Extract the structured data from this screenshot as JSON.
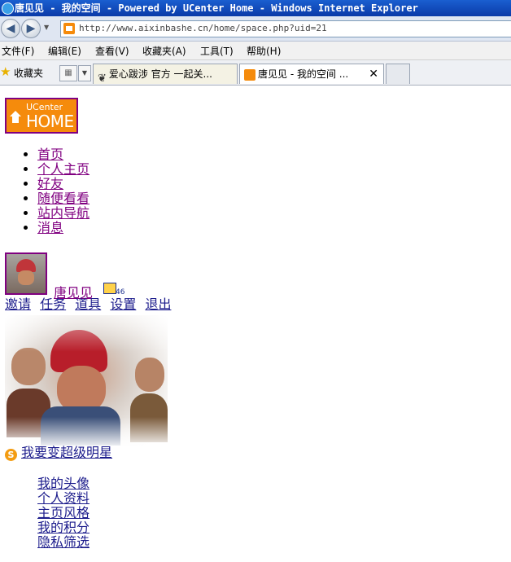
{
  "window": {
    "title": "唐见见 - 我的空间 - Powered by UCenter Home - Windows Internet Explorer"
  },
  "address_bar": {
    "url": "http://www.aixinbashe.cn/home/space.php?uid=21"
  },
  "menu": {
    "items": [
      "文件(F)",
      "编辑(E)",
      "查看(V)",
      "收藏夹(A)",
      "工具(T)",
      "帮助(H)"
    ]
  },
  "favorites_bar": {
    "label": "收藏夹",
    "tabs": [
      {
        "label": "爱心跋涉 官方 一起关..."
      },
      {
        "label": "唐见见 - 我的空间 ..."
      }
    ],
    "close_glyph": "✕"
  },
  "logo": {
    "line1": "UCenter",
    "line2": "HOME",
    "color": "#f58b0c"
  },
  "main_nav": [
    "首页",
    "个人主页",
    "好友",
    "随便看看",
    "站内导航",
    "消息"
  ],
  "user": {
    "name": "唐见见",
    "notice_count": "46"
  },
  "user_links": [
    "邀请",
    "任务",
    "道具",
    "设置",
    "退出"
  ],
  "star_link": "我要变超级明星",
  "sub_nav": [
    "我的头像",
    "个人资料",
    "主页风格",
    "我的积分",
    "隐私筛选"
  ]
}
